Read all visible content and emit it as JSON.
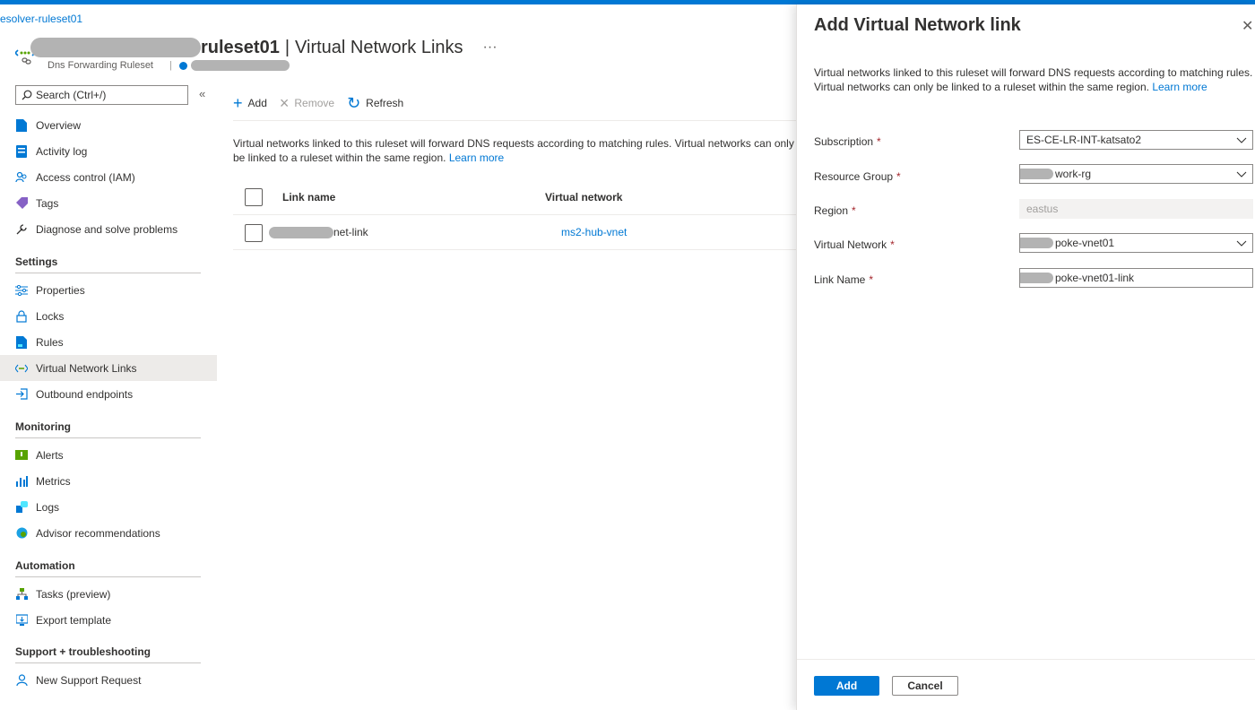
{
  "breadcrumb": "esolver-ruleset01",
  "header": {
    "title_bold": "ruleset01",
    "title_sep": "|",
    "title_rest": "Virtual Network Links",
    "more": "···",
    "subtitle": "Dns Forwarding Ruleset",
    "pipe": "|"
  },
  "search": {
    "placeholder": "Search (Ctrl+/)",
    "collapse": "«"
  },
  "nav": {
    "top_items": [
      {
        "label": "Overview",
        "icon": "overview-icon"
      },
      {
        "label": "Activity log",
        "icon": "activity-log-icon"
      },
      {
        "label": "Access control (IAM)",
        "icon": "people-icon"
      },
      {
        "label": "Tags",
        "icon": "tag-icon"
      },
      {
        "label": "Diagnose and solve problems",
        "icon": "wrench-icon"
      }
    ],
    "settings_title": "Settings",
    "settings_items": [
      {
        "label": "Properties",
        "icon": "sliders-icon"
      },
      {
        "label": "Locks",
        "icon": "lock-icon"
      },
      {
        "label": "Rules",
        "icon": "rules-icon"
      },
      {
        "label": "Virtual Network Links",
        "icon": "vnet-icon"
      },
      {
        "label": "Outbound endpoints",
        "icon": "endpoint-icon"
      }
    ],
    "monitoring_title": "Monitoring",
    "monitoring_items": [
      {
        "label": "Alerts",
        "icon": "alert-icon"
      },
      {
        "label": "Metrics",
        "icon": "metrics-icon"
      },
      {
        "label": "Logs",
        "icon": "logs-icon"
      },
      {
        "label": "Advisor recommendations",
        "icon": "advisor-icon"
      }
    ],
    "automation_title": "Automation",
    "automation_items": [
      {
        "label": "Tasks (preview)",
        "icon": "tasks-icon"
      },
      {
        "label": "Export template",
        "icon": "export-icon"
      }
    ],
    "support_title": "Support + troubleshooting",
    "support_items": [
      {
        "label": "New Support Request",
        "icon": "support-icon"
      }
    ]
  },
  "toolbar": {
    "add": "Add",
    "remove": "Remove",
    "refresh": "Refresh"
  },
  "main": {
    "description": "Virtual networks linked to this ruleset will forward DNS requests according to matching rules. Virtual networks can only be linked to a ruleset within the same region.",
    "learn_more": "Learn more",
    "columns": [
      "Link name",
      "Virtual network"
    ],
    "rows": [
      {
        "link_name": "net-link",
        "virtual_network": "ms2-hub-vnet"
      }
    ]
  },
  "panel": {
    "title": "Add Virtual Network link",
    "close": "✕",
    "description": "Virtual networks linked to this ruleset will forward DNS requests according to matching rules. Virtual networks can only be linked to a ruleset within the same region.",
    "learn_more": "Learn more",
    "required_mark": "*",
    "fields": {
      "subscription": {
        "label": "Subscription",
        "value": "ES-CE-LR-INT-katsato2"
      },
      "resource_group": {
        "label": "Resource Group",
        "value": "work-rg"
      },
      "region": {
        "label": "Region",
        "value": "eastus"
      },
      "virtual_network": {
        "label": "Virtual Network",
        "value": "poke-vnet01"
      },
      "link_name": {
        "label": "Link Name",
        "value": "poke-vnet01-link"
      }
    },
    "add_button": "Add",
    "cancel_button": "Cancel"
  },
  "colors": {
    "accent": "#0078d4",
    "required": "#a4262c"
  }
}
